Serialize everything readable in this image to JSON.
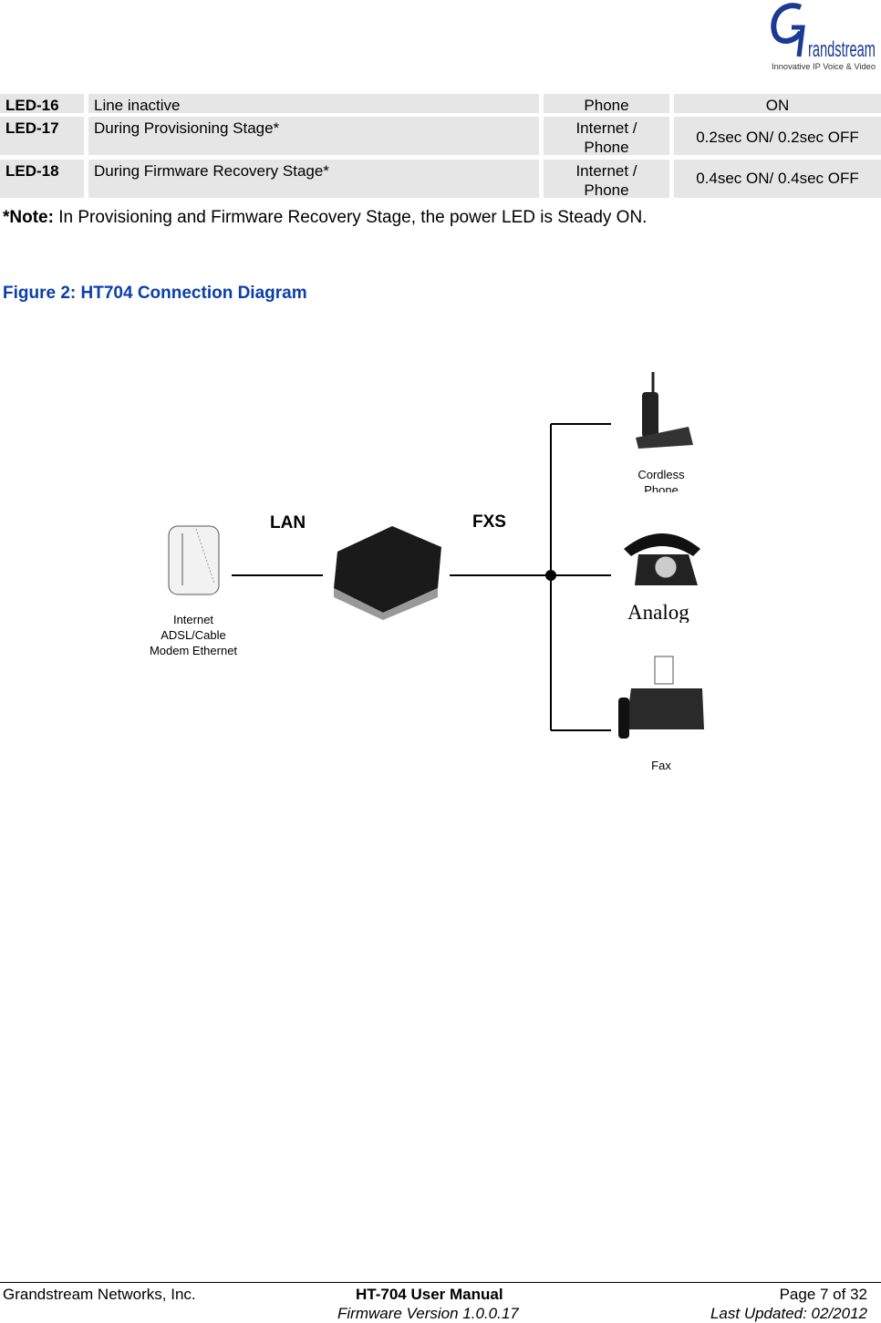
{
  "logo": {
    "brand": "Grandstream",
    "tagline": "Innovative IP Voice & Video",
    "color": "#1b3a94"
  },
  "table": {
    "rows": [
      {
        "id": "LED-16",
        "description": "Line inactive",
        "type_line1": "Phone",
        "type_line2": "",
        "pattern": "ON"
      },
      {
        "id": "LED-17",
        "description": "During Provisioning Stage*",
        "type_line1": "Internet /",
        "type_line2": "Phone",
        "pattern": "0.2sec ON/ 0.2sec OFF"
      },
      {
        "id": "LED-18",
        "description": "During Firmware Recovery Stage*",
        "type_line1": "Internet /",
        "type_line2": "Phone",
        "pattern": "0.4sec ON/ 0.4sec OFF"
      }
    ]
  },
  "note": {
    "label": "*Note:",
    "text": " In Provisioning and Firmware Recovery Stage, the power LED is Steady ON."
  },
  "figure": {
    "caption": "Figure 2:  HT704 Connection Diagram",
    "color": "#0b3fa8",
    "labels": {
      "lan": "LAN",
      "fxs": "FXS",
      "modem_1": "Internet",
      "modem_2": "ADSL/Cable",
      "modem_3": "Modem Ethernet",
      "cordless_1": "Cordless",
      "cordless_2": "Phone",
      "analog": "Analog",
      "fax": "Fax"
    }
  },
  "footer": {
    "company": "Grandstream Networks, Inc.",
    "title": "HT-704 User Manual",
    "firmware": "Firmware Version 1.0.0.17",
    "page": "Page 7 of 32",
    "updated": "Last Updated: 02/2012"
  }
}
